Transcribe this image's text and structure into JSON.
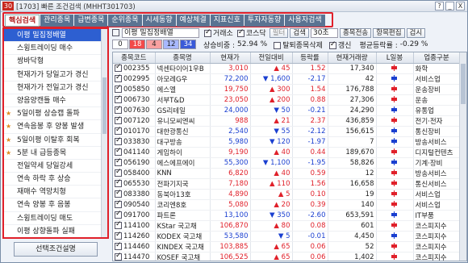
{
  "window": {
    "title": "[1703] 빠른 조건검색 (MHHT301703)",
    "badge": "30",
    "btn_help": "?",
    "btn_min": "_",
    "btn_close": "X"
  },
  "tabs": [
    "핵심검색",
    "관리종목",
    "급변종목",
    "순위종목",
    "시세동향",
    "예상체결",
    "지표신호",
    "투자자동향",
    "사용자검색"
  ],
  "tab_right": {
    "edit": "항목편집",
    "search": "검시"
  },
  "sidebar": {
    "items": [
      {
        "label": "이평 밀집정배열",
        "selected": true,
        "mark": ""
      },
      {
        "label": "스윙트레이딩 매수",
        "selected": false,
        "mark": ""
      },
      {
        "label": "쌍바닥형",
        "selected": false,
        "mark": ""
      },
      {
        "label": "현재가가 당일고가 경신",
        "selected": false,
        "mark": ""
      },
      {
        "label": "현재가가 전일고가 경신",
        "selected": false,
        "mark": ""
      },
      {
        "label": "양음양캔틀 매수",
        "selected": false,
        "mark": ""
      },
      {
        "label": "5일이평 상승캡 돌파",
        "selected": false,
        "mark": "★"
      },
      {
        "label": "연속음봉 후 양봉 발생",
        "selected": false,
        "mark": "★"
      },
      {
        "label": "5일이평 이탈후 회복",
        "selected": false,
        "mark": "★"
      },
      {
        "label": "5분 내 급등종목",
        "selected": false,
        "mark": "★"
      },
      {
        "label": "전일약세 당일강세",
        "selected": false,
        "mark": ""
      },
      {
        "label": "연속 하락 후 상승",
        "selected": false,
        "mark": ""
      },
      {
        "label": "재매수 역망치형",
        "selected": false,
        "mark": ""
      },
      {
        "label": "연속 양봉 후 음봉",
        "selected": false,
        "mark": ""
      },
      {
        "label": "스윙트레이딩 매도",
        "selected": false,
        "mark": ""
      },
      {
        "label": "이평 상향돌파 실패",
        "selected": false,
        "mark": ""
      },
      {
        "label": "세력이탈 역망치형",
        "selected": false,
        "mark": ""
      }
    ],
    "bottom_button": "선택조건설명"
  },
  "toolbar": {
    "search_label": "이평 밀집정배열",
    "chk_exchange": "거래소",
    "chk_kosdaq": "코스닥",
    "filter": "필터",
    "search_btn": "검색",
    "interval_value": "30초",
    "search_all": "종목전송",
    "edit_items": "항목편집",
    "search": "검시"
  },
  "toolbar2": {
    "boxes": [
      "0",
      "18",
      "4",
      "12",
      "34"
    ],
    "rise_ratio_label": "상승비중 :",
    "rise_ratio": "52.94 %",
    "chk_stop": "탈퇴종목삭제",
    "chk_refresh": "갱신",
    "avg_label": "평균등락률 :",
    "avg": "-0.29 %"
  },
  "table": {
    "headers": [
      "종목코드",
      "종목명",
      "현재가",
      "전일대비",
      "등락률",
      "현재거래량",
      "L일봉",
      "업종구분"
    ],
    "rows": [
      {
        "code": "002355",
        "name": "넥센타이어1우B",
        "price": "3,010",
        "chg": "45",
        "rate": "1.52",
        "vol": "17,340",
        "sector": "화학",
        "dir": "up"
      },
      {
        "code": "002995",
        "name": "아모레G우",
        "price": "72,200",
        "chg": "1,600",
        "rate": "-2.17",
        "vol": "42",
        "sector": "서비스업",
        "dir": "dn"
      },
      {
        "code": "005850",
        "name": "에스엘",
        "price": "19,750",
        "chg": "300",
        "rate": "1.54",
        "vol": "176,788",
        "sector": "운송장비",
        "dir": "up"
      },
      {
        "code": "006730",
        "name": "서부T&D",
        "price": "23,050",
        "chg": "200",
        "rate": "0.88",
        "vol": "27,306",
        "sector": "운송",
        "dir": "up"
      },
      {
        "code": "007630",
        "name": "GS리테일",
        "price": "24,000",
        "chg": "50",
        "rate": "-0.21",
        "vol": "24,290",
        "sector": "유통업",
        "dir": "dn"
      },
      {
        "code": "007120",
        "name": "유니모씨엔씨",
        "price": "988",
        "chg": "21",
        "rate": "2.37",
        "vol": "436,859",
        "sector": "전기·전자",
        "dir": "up"
      },
      {
        "code": "010170",
        "name": "대한광통신",
        "price": "2,540",
        "chg": "55",
        "rate": "-2.12",
        "vol": "156,615",
        "sector": "통신장비",
        "dir": "dn"
      },
      {
        "code": "033830",
        "name": "대구방송",
        "price": "5,980",
        "chg": "120",
        "rate": "-1.97",
        "vol": "7",
        "sector": "방송서비스",
        "dir": "dn"
      },
      {
        "code": "041140",
        "name": "게임하이",
        "price": "9,190",
        "chg": "40",
        "rate": "0.44",
        "vol": "189,670",
        "sector": "디지털컨텐츠",
        "dir": "up"
      },
      {
        "code": "056190",
        "name": "에스에프에이",
        "price": "55,300",
        "chg": "1,100",
        "rate": "-1.95",
        "vol": "58,826",
        "sector": "기계·장비",
        "dir": "dn"
      },
      {
        "code": "058400",
        "name": "KNN",
        "price": "6,820",
        "chg": "40",
        "rate": "0.59",
        "vol": "12",
        "sector": "방송서비스",
        "dir": "up"
      },
      {
        "code": "065530",
        "name": "전파기지국",
        "price": "7,180",
        "chg": "110",
        "rate": "1.56",
        "vol": "16,658",
        "sector": "통신서비스",
        "dir": "up"
      },
      {
        "code": "083380",
        "name": "동북아13호",
        "price": "4,890",
        "chg": "5",
        "rate": "0.10",
        "vol": "19",
        "sector": "서비스업",
        "dir": "up"
      },
      {
        "code": "090540",
        "name": "코리엔8호",
        "price": "5,080",
        "chg": "20",
        "rate": "0.39",
        "vol": "140",
        "sector": "서비스업",
        "dir": "up"
      },
      {
        "code": "091700",
        "name": "파트론",
        "price": "13,100",
        "chg": "350",
        "rate": "-2.60",
        "vol": "653,591",
        "sector": "IT부품",
        "dir": "dn"
      },
      {
        "code": "114100",
        "name": "KStar 국고채",
        "price": "106,870",
        "chg": "80",
        "rate": "0.08",
        "vol": "601",
        "sector": "코스피지수",
        "dir": "up"
      },
      {
        "code": "114260",
        "name": "KODEX 국고채",
        "price": "53,580",
        "chg": "5",
        "rate": "-0.01",
        "vol": "4,450",
        "sector": "코스피지수",
        "dir": "dn"
      },
      {
        "code": "114460",
        "name": "KINDEX 국고채",
        "price": "103,885",
        "chg": "65",
        "rate": "0.06",
        "vol": "52",
        "sector": "코스피지수",
        "dir": "up"
      },
      {
        "code": "114470",
        "name": "KOSEF 국고채",
        "price": "106,525",
        "chg": "65",
        "rate": "0.06",
        "vol": "1,402",
        "sector": "코스피지수",
        "dir": "up"
      }
    ]
  },
  "colors": {
    "up": "#e0202a",
    "down": "#1a3fd0",
    "selected": "#2d5fd1",
    "accent_border": "#e0202a"
  }
}
